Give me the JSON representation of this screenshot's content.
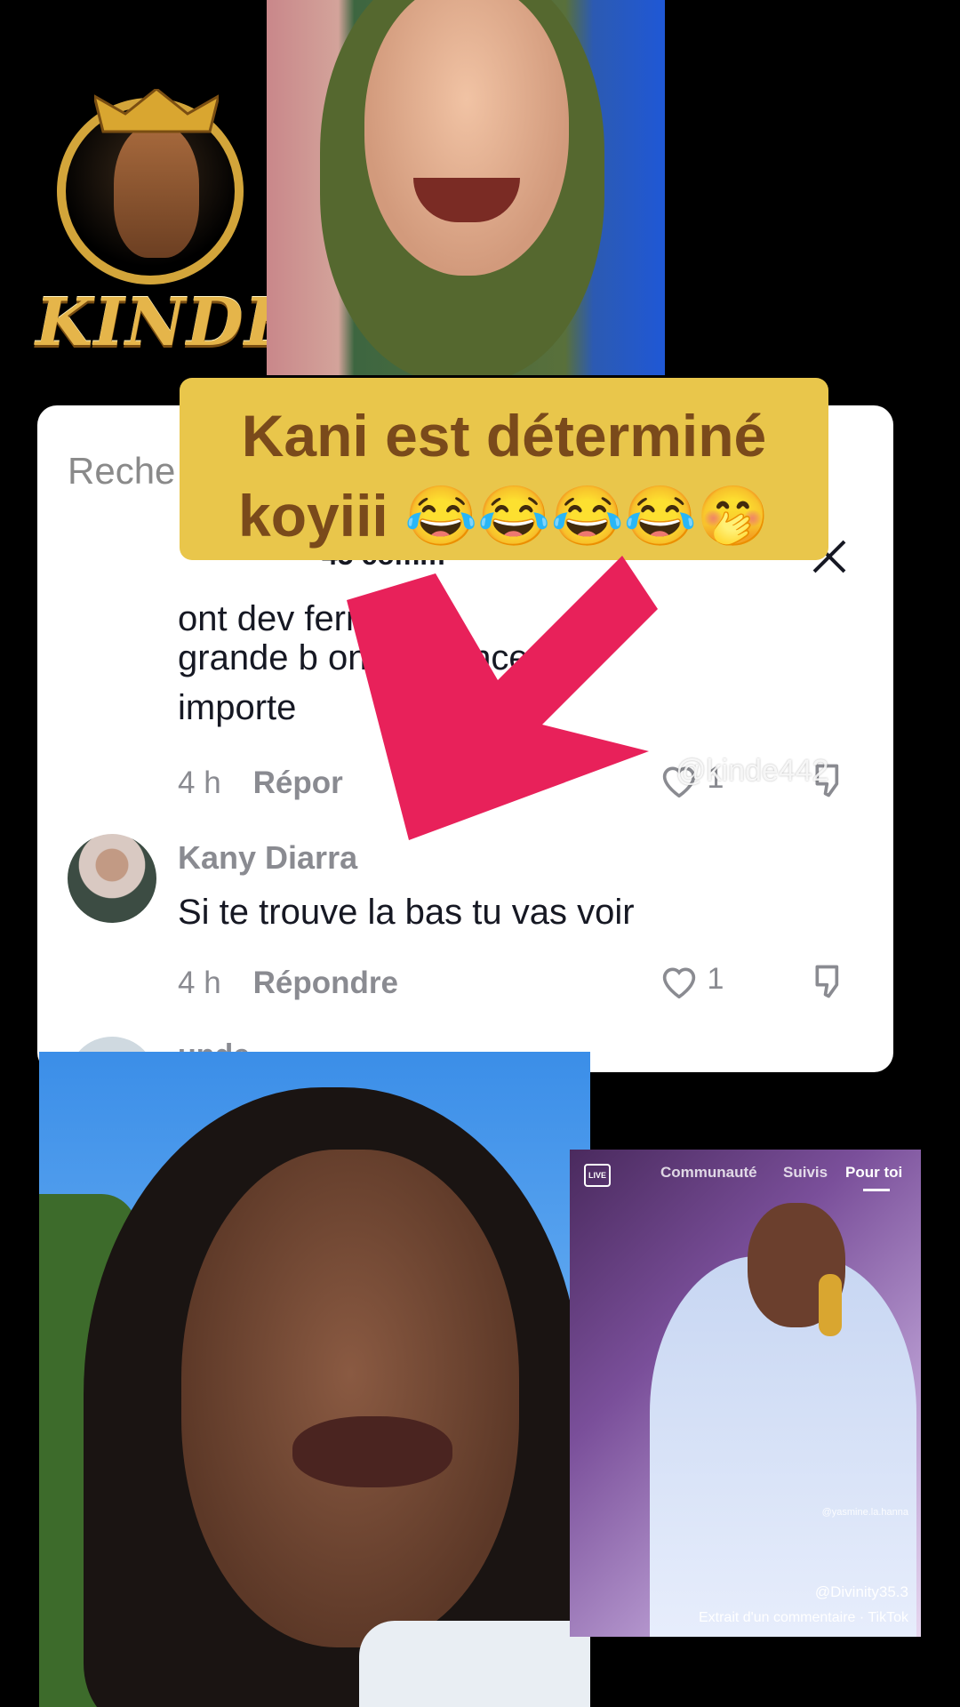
{
  "logo": {
    "wordmark": "KINDE"
  },
  "caption": {
    "line1": "Kani est déterminé",
    "line2": "koyiii 😂😂😂😂🤭"
  },
  "comments_panel": {
    "search_hint": "Reche",
    "count_label": "45 comm",
    "partial_comment": {
      "line1": "ont dev                          ferme t'a",
      "line2": "grande b                         ont n'avance",
      "line3": "importe",
      "time": "4 h",
      "reply_label": "Répor",
      "likes": "1"
    },
    "comments": [
      {
        "author": "Kany Diarra",
        "text": "Si te trouve la bas tu vas voir",
        "time": "4 h",
        "reply_label": "Répondre",
        "likes": "1"
      }
    ],
    "next_author_partial": "unde"
  },
  "watermark": "@kinde442",
  "inset_video": {
    "tabs": [
      "Communauté",
      "Suivis",
      "Pour toi"
    ],
    "live_label": "LIVE",
    "small_handle": "@yasmine.la.hanna",
    "handle": "@Divinity35.3",
    "source": "Extrait d'un commentaire · TikTok"
  }
}
